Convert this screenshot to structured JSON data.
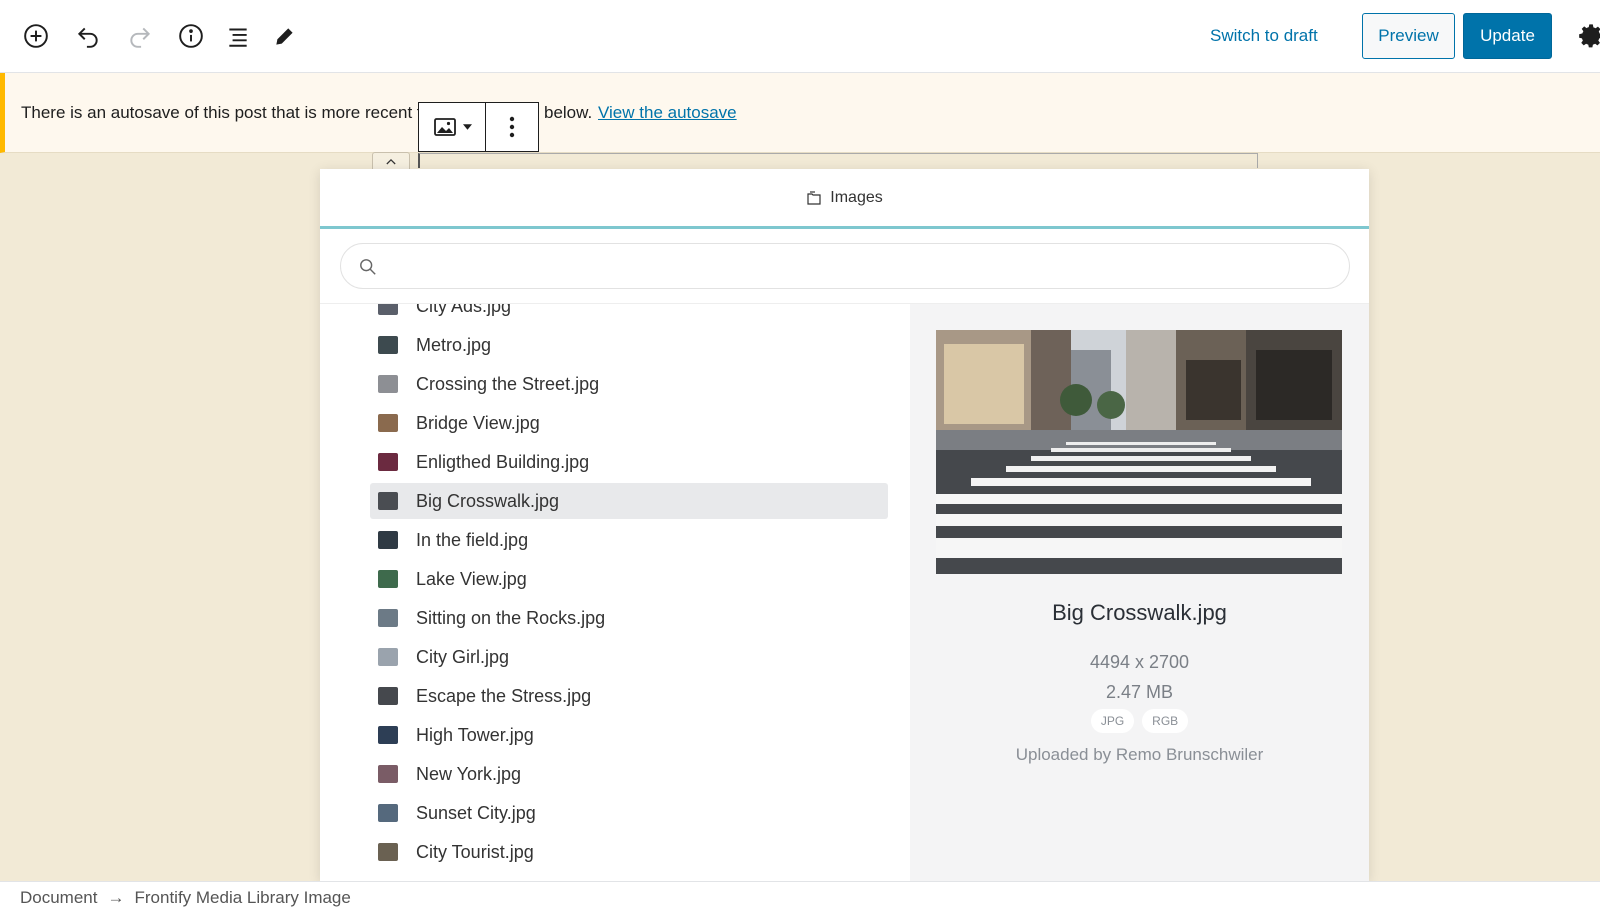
{
  "toolbar": {
    "switch_draft_label": "Switch to draft",
    "preview_label": "Preview",
    "update_label": "Update",
    "icons": [
      "plus-circle-icon",
      "undo-icon",
      "redo-icon",
      "info-icon",
      "list-view-icon",
      "edit-pencil-icon",
      "gear-icon"
    ]
  },
  "notice": {
    "text_before": "There is an autosave of this post that is more recent t",
    "text_after": "below.",
    "link_label": "View the autosave"
  },
  "modal": {
    "title": "Images",
    "search": {
      "value": "",
      "placeholder": ""
    },
    "items": [
      {
        "label": "City Ads.jpg",
        "thumb": "#5a5f6a"
      },
      {
        "label": "Metro.jpg",
        "thumb": "#3d4a4f"
      },
      {
        "label": "Crossing the Street.jpg",
        "thumb": "#8d8f94"
      },
      {
        "label": "Bridge View.jpg",
        "thumb": "#8a6a4e"
      },
      {
        "label": "Enligthed Building.jpg",
        "thumb": "#6b2a40"
      },
      {
        "label": "Big Crosswalk.jpg",
        "thumb": "#4a4d52",
        "selected": true
      },
      {
        "label": "In the field.jpg",
        "thumb": "#2f3a44"
      },
      {
        "label": "Lake View.jpg",
        "thumb": "#3e6a4c"
      },
      {
        "label": "Sitting on the Rocks.jpg",
        "thumb": "#6c7a86"
      },
      {
        "label": "City Girl.jpg",
        "thumb": "#9aa3ad"
      },
      {
        "label": "Escape the Stress.jpg",
        "thumb": "#45484d"
      },
      {
        "label": "High Tower.jpg",
        "thumb": "#2d3e55"
      },
      {
        "label": "New York.jpg",
        "thumb": "#7a5c66"
      },
      {
        "label": "Sunset City.jpg",
        "thumb": "#55697d"
      },
      {
        "label": "City Tourist.jpg",
        "thumb": "#6a6152"
      },
      {
        "label": "",
        "thumb": "#777a80"
      }
    ],
    "detail": {
      "name": "Big Crosswalk.jpg",
      "dimensions": "4494 x 2700",
      "size": "2.47 MB",
      "tags": [
        "JPG",
        "RGB"
      ],
      "uploader": "Uploaded by Remo Brunschwiler"
    }
  },
  "footer": {
    "crumb_document": "Document",
    "separator": "→",
    "crumb_block": "Frontify Media Library Image"
  },
  "colors": {
    "accent": "#0073aa",
    "notice_border": "#ffb900",
    "modal_header_underline": "#7ec7cf",
    "canvas_bg": "#f2ead6"
  }
}
